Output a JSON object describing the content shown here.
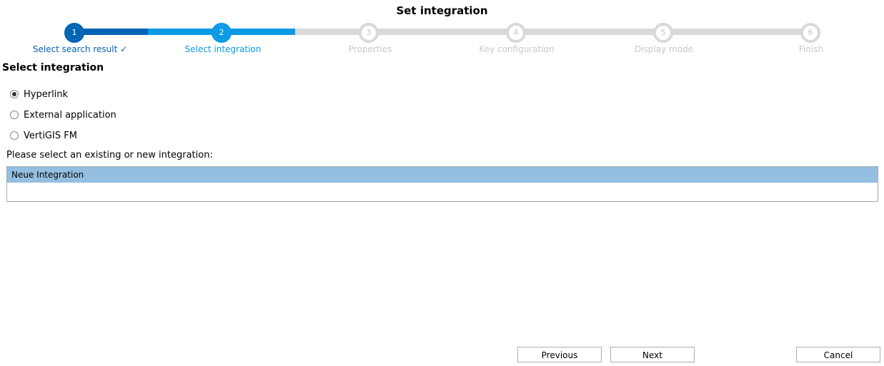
{
  "window": {
    "title": "Set integration"
  },
  "wizard": {
    "steps": [
      {
        "number": "1",
        "label": "Select search result ✓"
      },
      {
        "number": "2",
        "label": "Select integration"
      },
      {
        "number": "3",
        "label": "Properties"
      },
      {
        "number": "4",
        "label": "Key configuration"
      },
      {
        "number": "5",
        "label": "Display mode"
      },
      {
        "number": "6",
        "label": "Finish"
      }
    ],
    "colors": {
      "done": "#0064b4",
      "current": "#0a9ae6",
      "inactive": "#d9d9d9"
    }
  },
  "section": {
    "title": "Select integration"
  },
  "integration_type": {
    "options": [
      "Hyperlink",
      "External application",
      "VertiGIS FM"
    ],
    "selected": "Hyperlink"
  },
  "integration_list": {
    "prompt": "Please select an existing or new integration:",
    "items": [
      "Neue Integration"
    ],
    "selected_index": 0
  },
  "footer": {
    "previous_label": "Previous",
    "next_label": "Next",
    "cancel_label": "Cancel"
  }
}
